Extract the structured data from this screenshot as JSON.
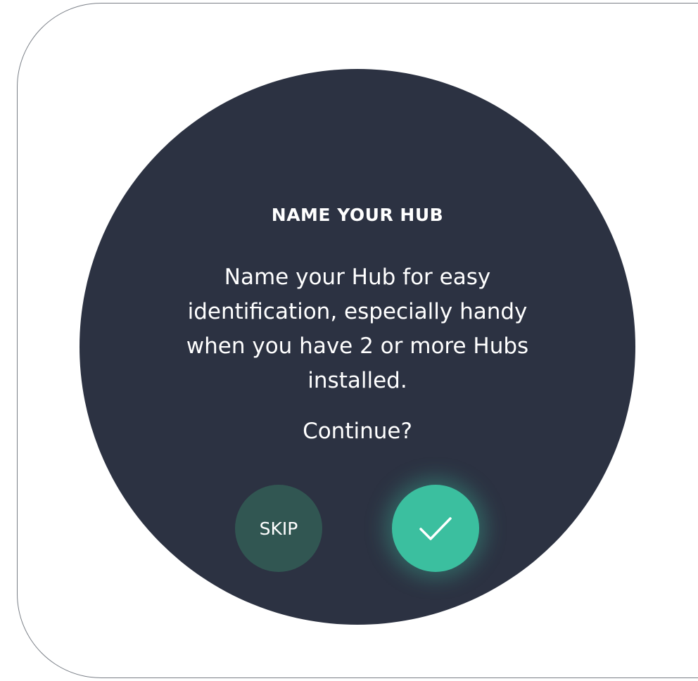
{
  "dialog": {
    "title": "NAME YOUR HUB",
    "message": "Name your Hub for easy identification, especially handy when you have 2 or more Hubs installed.",
    "question": "Continue?"
  },
  "buttons": {
    "skip_label": "SKIP",
    "confirm_icon": "checkmark-icon"
  },
  "colors": {
    "background": "#2c3242",
    "skip_button": "#315652",
    "confirm_button": "#3bbf9f",
    "text": "#ffffff"
  }
}
